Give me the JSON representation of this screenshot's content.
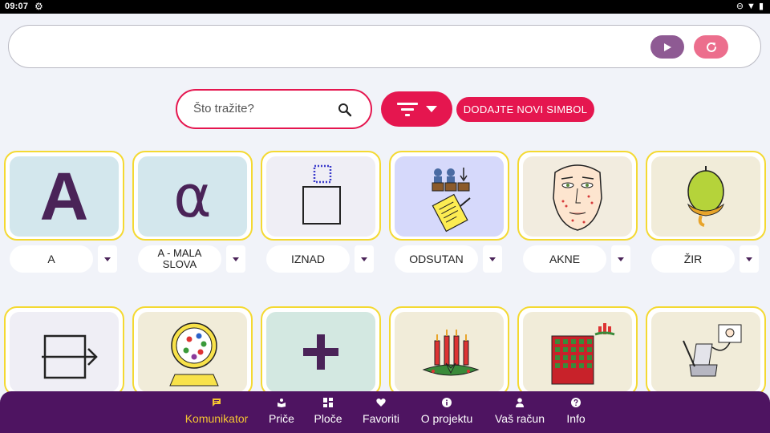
{
  "status_bar": {
    "time": "09:07"
  },
  "sentence_bar": {
    "text": ""
  },
  "search": {
    "placeholder": "Što tražite?"
  },
  "toolbar": {
    "add_symbol_label": "DODAJTE NOVI SIMBOL"
  },
  "symbols_row1": [
    {
      "label": "A",
      "letter": "A",
      "bg": "#d3e7ed"
    },
    {
      "label": "A - MALA SLOVA",
      "letter": "α",
      "bg": "#d3e7ed"
    },
    {
      "label": "IZNAD",
      "bg": "#efeef5"
    },
    {
      "label": "ODSUTAN",
      "bg": "#d6d9fb"
    },
    {
      "label": "AKNE",
      "bg": "#f2ecdf"
    },
    {
      "label": "ŽIR",
      "bg": "#f1ecd9"
    }
  ],
  "symbols_row2": [
    {
      "bg": "#efeef5"
    },
    {
      "bg": "#f1ecd9"
    },
    {
      "bg": "#d3e8e1"
    },
    {
      "bg": "#f1ecd9"
    },
    {
      "bg": "#f1ecd9"
    },
    {
      "bg": "#f1ecd9"
    }
  ],
  "nav": [
    {
      "label": "Komunikator",
      "icon": "chat-icon",
      "active": true
    },
    {
      "label": "Priče",
      "icon": "book-icon"
    },
    {
      "label": "Ploče",
      "icon": "grid-icon"
    },
    {
      "label": "Favoriti",
      "icon": "heart-icon"
    },
    {
      "label": "O projektu",
      "icon": "info-icon"
    },
    {
      "label": "Vaš račun",
      "icon": "person-icon"
    },
    {
      "label": "Info",
      "icon": "help-icon"
    }
  ],
  "colors": {
    "accent": "#e5164f",
    "nav_bg": "#4e1461",
    "active_nav": "#f4c432",
    "tile_border": "#f4d932",
    "play": "#8e5a93",
    "reset": "#ec6e8d"
  }
}
